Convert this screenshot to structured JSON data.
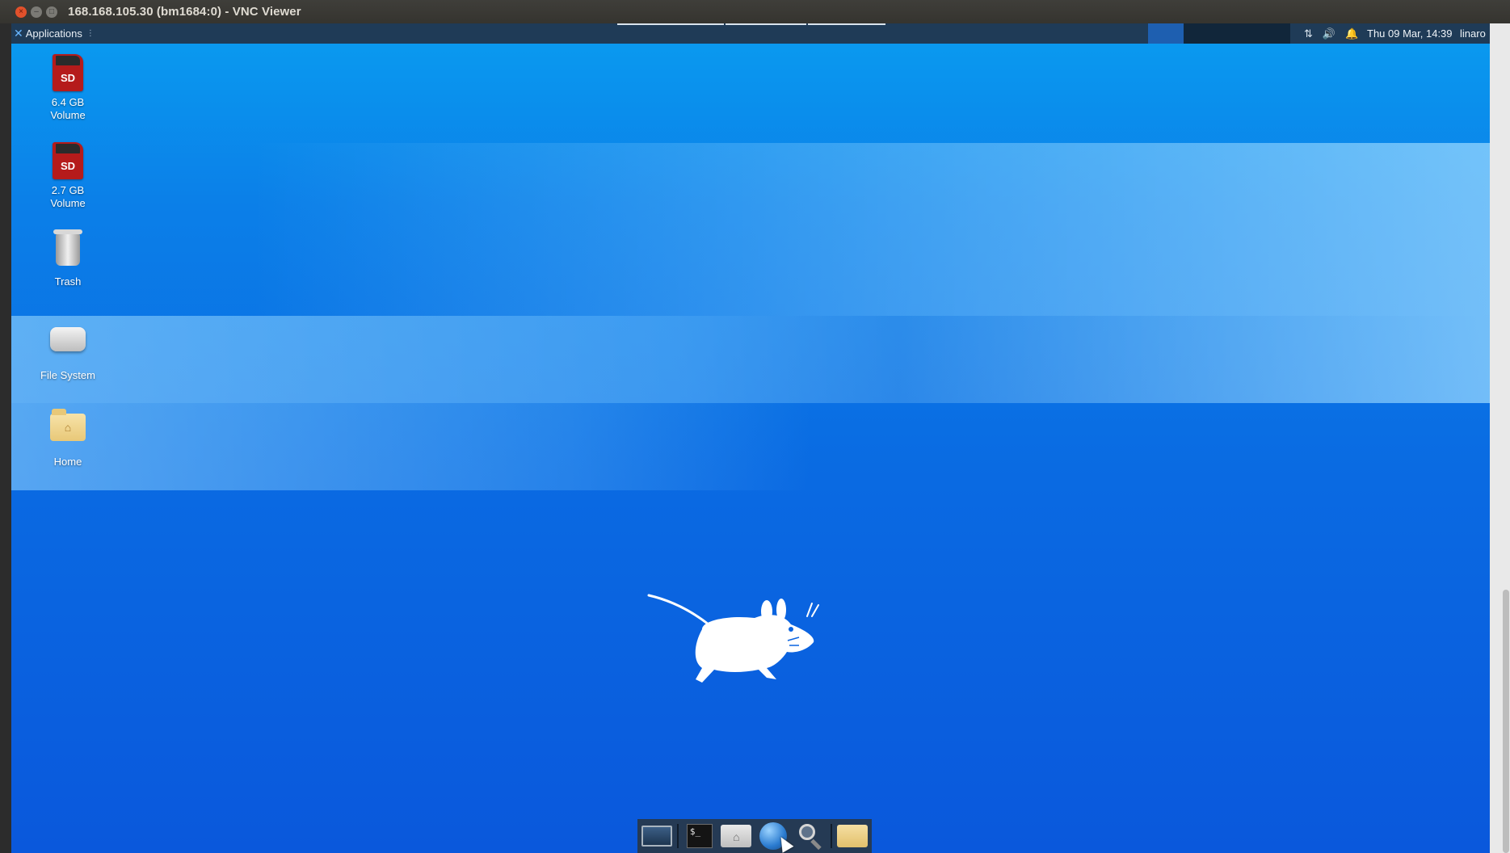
{
  "vnc_window": {
    "title": "168.168.105.30 (bm1684:0) - VNC Viewer",
    "buttons": {
      "close": "×",
      "minimize": "–",
      "maximize": "□"
    }
  },
  "panel": {
    "applications_label": "Applications",
    "applications_icon": "xfce-logo-icon",
    "clock": "Thu 09 Mar, 14:39",
    "user": "linaro",
    "tray_icons": [
      "network-icon",
      "volume-icon",
      "notification-bell-icon"
    ],
    "workspaces_count": 4,
    "active_workspace": 1
  },
  "desktop": {
    "icons": [
      {
        "name": "sd-card-icon",
        "badge": "SD",
        "line1": "6.4 GB",
        "line2": "Volume"
      },
      {
        "name": "sd-card-icon",
        "badge": "SD",
        "line1": "2.7 GB",
        "line2": "Volume"
      },
      {
        "name": "trash-icon",
        "line1": "Trash"
      },
      {
        "name": "hard-drive-icon",
        "line1": "File System"
      },
      {
        "name": "home-folder-icon",
        "line1": "Home"
      }
    ]
  },
  "dock": {
    "items": [
      {
        "name": "show-desktop-icon"
      },
      {
        "name": "terminal-icon",
        "glyph": "$_"
      },
      {
        "name": "file-manager-icon"
      },
      {
        "name": "web-browser-icon"
      },
      {
        "name": "app-finder-icon"
      },
      {
        "name": "files-folder-icon"
      }
    ]
  },
  "colors": {
    "panel_bg": "#1f3b57",
    "desktop_top": "#0a9cf0",
    "desktop_bottom": "#0a58dc",
    "active_workspace": "#1e5fb0"
  }
}
